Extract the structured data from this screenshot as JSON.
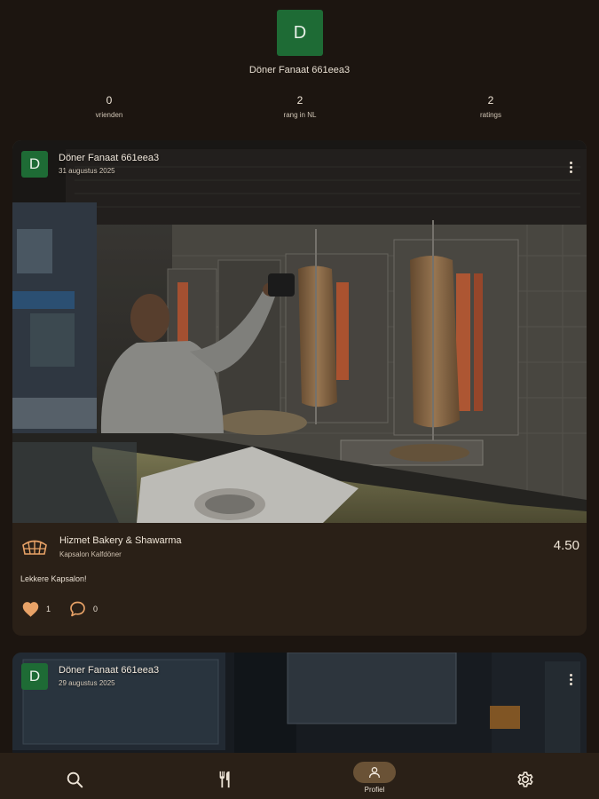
{
  "profile": {
    "avatar_letter": "D",
    "name": "Döner Fanaat 661eea3",
    "stats": [
      {
        "value": "0",
        "label": "vrienden"
      },
      {
        "value": "2",
        "label": "rang in NL"
      },
      {
        "value": "2",
        "label": "ratings"
      }
    ]
  },
  "posts": [
    {
      "avatar_letter": "D",
      "author": "Döner Fanaat 661eea3",
      "date": "31 augustus 2025",
      "place_icon": "bakery-icon",
      "place_name": "Hizmet Bakery & Shawarma",
      "dish": "Kapsalon Kalfdöner",
      "rating": "4.50",
      "caption": "Lekkere Kapsalon!",
      "likes": "1",
      "comments": "0"
    },
    {
      "avatar_letter": "D",
      "author": "Döner Fanaat 661eea3",
      "date": "29 augustus 2025"
    }
  ],
  "nav": {
    "items": [
      {
        "icon": "search-icon"
      },
      {
        "icon": "fork-knife-icon"
      },
      {
        "icon": "person-icon",
        "label": "Profiel",
        "active": true
      },
      {
        "icon": "gear-icon"
      }
    ]
  },
  "colors": {
    "background": "#1c1510",
    "card": "#2a2017",
    "avatar": "#1e6b35",
    "accent": "#e8a267",
    "active_pill": "#6a5236"
  }
}
